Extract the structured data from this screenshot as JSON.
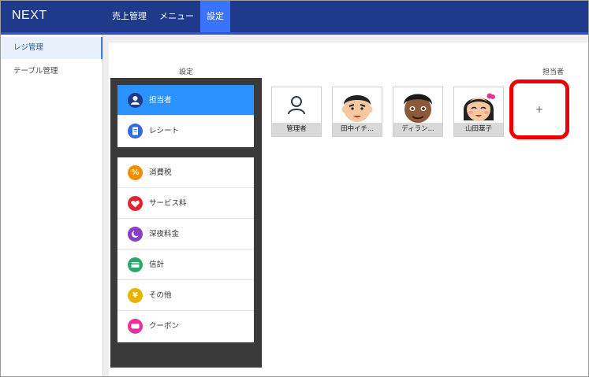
{
  "app": {
    "brand": "NEXT"
  },
  "topnav": {
    "items": [
      {
        "label": "売上管理"
      },
      {
        "label": "メニュー"
      },
      {
        "label": "設定"
      }
    ]
  },
  "sidebar": {
    "items": [
      {
        "label": "レジ管理"
      },
      {
        "label": "テーブル管理"
      }
    ]
  },
  "columns": {
    "settings_title": "設定",
    "staff_title": "担当者"
  },
  "settings_menu": {
    "group1": [
      {
        "label": "担当者",
        "icon": "person-icon",
        "color": "#1f3a8a"
      },
      {
        "label": "レシート",
        "icon": "receipt-icon",
        "color": "#2d6be0"
      }
    ],
    "group2": [
      {
        "label": "消費税",
        "icon": "percent-icon",
        "color": "#f08c00"
      },
      {
        "label": "サービス料",
        "icon": "heart-icon",
        "color": "#e5232e"
      },
      {
        "label": "深夜料金",
        "icon": "moon-icon",
        "color": "#8a3fc1"
      },
      {
        "label": "信計",
        "icon": "card-icon",
        "color": "#2aa86b"
      },
      {
        "label": "その他",
        "icon": "yen-icon",
        "color": "#e6b400"
      },
      {
        "label": "クーポン",
        "icon": "ticket-icon",
        "color": "#e6329a"
      }
    ]
  },
  "staff": [
    {
      "name": "管理者"
    },
    {
      "name": "田中イチ..."
    },
    {
      "name": "ディラン..."
    },
    {
      "name": "山田華子"
    }
  ],
  "add_staff": {
    "label": "+"
  }
}
